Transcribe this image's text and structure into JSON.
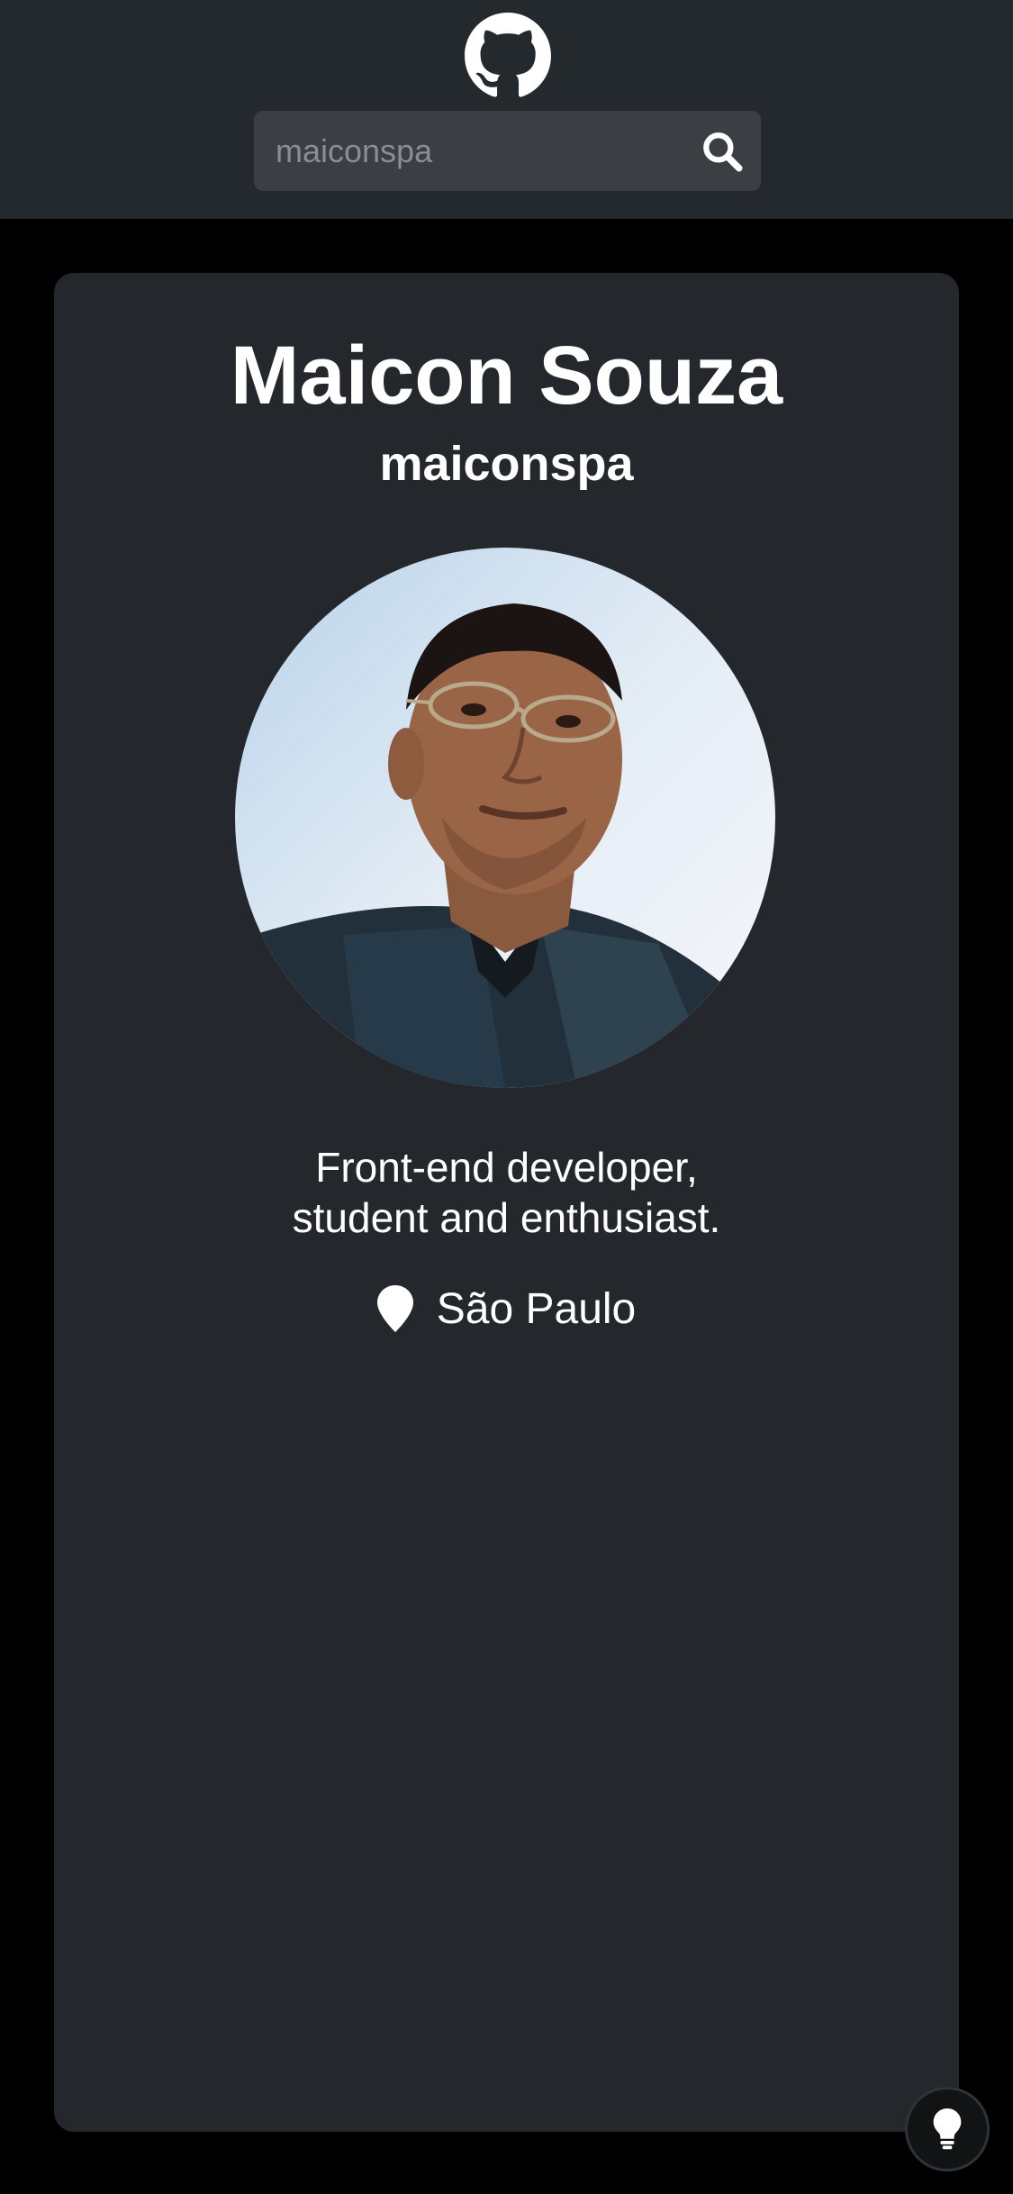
{
  "header": {
    "logo": "github-icon",
    "search": {
      "placeholder": "maiconspa",
      "value": "",
      "button_icon": "search-icon"
    }
  },
  "profile": {
    "name": "Maicon Souza",
    "login": "maiconspa",
    "avatar": "avatar-photo",
    "bio_line1": "Front-end developer,",
    "bio_line2": "student and enthusiast.",
    "location": "São Paulo",
    "location_icon": "map-pin-icon"
  },
  "theme_toggle": {
    "icon": "lightbulb-icon"
  },
  "colors": {
    "header_bg": "#24292e",
    "page_bg": "#000000",
    "card_bg": "#24282c",
    "search_bg": "#3b3f43",
    "text": "#ffffff"
  }
}
